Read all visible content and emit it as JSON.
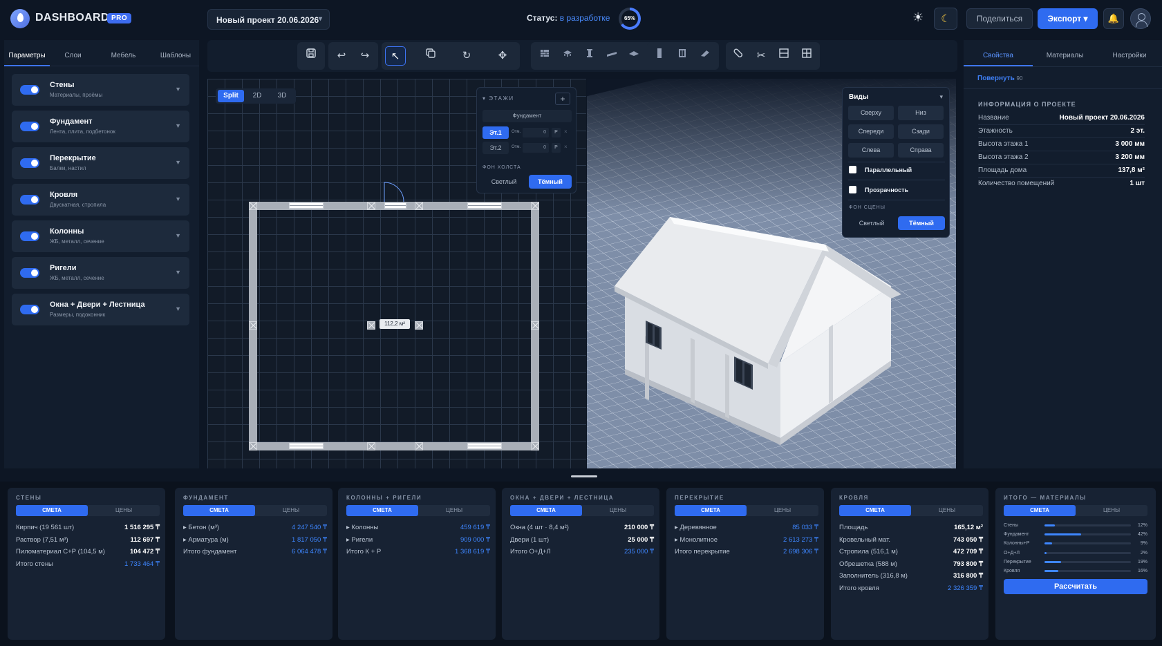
{
  "app": {
    "title": "DASHBOARD",
    "badge": "PRO"
  },
  "header": {
    "project": "Новый проект 20.06.2026",
    "status_label": "Статус:",
    "status_value": "в разработке",
    "progress_text": "65%",
    "progress_value": 65,
    "share": "Поделиться",
    "export": "Экспорт ▾"
  },
  "left": {
    "tabs": [
      "Параметры",
      "Слои",
      "Мебель",
      "Шаблоны"
    ],
    "layers": [
      {
        "title": "Стены",
        "sub": "Материалы, проёмы"
      },
      {
        "title": "Фундамент",
        "sub": "Лента, плита, подбетонок"
      },
      {
        "title": "Перекрытие",
        "sub": "Балки, настил"
      },
      {
        "title": "Кровля",
        "sub": "Двускатная, стропила"
      },
      {
        "title": "Колонны",
        "sub": "ЖБ, металл, сечение"
      },
      {
        "title": "Ригели",
        "sub": "ЖБ, металл, сечение"
      },
      {
        "title": "Окна + Двери + Лестница",
        "sub": "Размеры, подоконник"
      }
    ]
  },
  "canvas": {
    "modes": [
      "Split",
      "2D",
      "3D"
    ],
    "area": "112,2 м²",
    "floors": {
      "title": "▾ ЭТАЖИ",
      "plus": "+",
      "foundation": "Фундамент",
      "rows": [
        {
          "name": "Эт.1",
          "otm": "Отм.",
          "val": "0",
          "p": "Р",
          "x": "×"
        },
        {
          "name": "Эт.2",
          "otm": "Отм.",
          "val": "0",
          "p": "Р",
          "x": "×"
        }
      ],
      "bg_title": "ФОН ХОЛСТА",
      "light": "Светлый",
      "dark": "Тёмный"
    }
  },
  "views": {
    "title": "Виды",
    "chev": "▾",
    "buttons": [
      "Сверху",
      "Низ",
      "Спереди",
      "Сзади",
      "Слева",
      "Справа"
    ],
    "parallel": "Параллельный",
    "transparent": "Прозрачность",
    "bg_title": "ФОН СЦЕНЫ",
    "light": "Светлый",
    "dark": "Тёмный"
  },
  "right": {
    "tabs": [
      "Свойства",
      "Материалы",
      "Настройки"
    ],
    "sub": "Повернуть",
    "sub_hint": "90",
    "section": "ИНФОРМАЦИЯ О ПРОЕКТЕ",
    "props": [
      {
        "k": "Название",
        "v": "Новый проект 20.06.2026"
      },
      {
        "k": "Этажность",
        "v": "2 эт."
      },
      {
        "k": "Высота этажа 1",
        "v": "3 000 мм"
      },
      {
        "k": "Высота этажа 2",
        "v": "3 200 мм"
      },
      {
        "k": "Площадь дома",
        "v": "137,8 м²"
      },
      {
        "k": "Количество помещений",
        "v": "1 шт"
      }
    ]
  },
  "bottom": {
    "seg_a": "СМЕТА",
    "seg_b": "ЦЕНЫ",
    "cards": [
      {
        "title": "СТЕНЫ",
        "rows": [
          {
            "k": "Кирпич (19 561 шт)",
            "v": "1 516 295 ₸",
            "blue": false
          },
          {
            "k": "Раствор (7,51 м³)",
            "v": "112 697 ₸",
            "blue": false
          },
          {
            "k": "Пиломатериал С+Р (104,5 м)",
            "v": "104 472 ₸",
            "blue": false
          },
          {
            "k": "Итого стены",
            "v": "1 733 464 ₸",
            "blue": true
          }
        ]
      },
      {
        "title": "ФУНДАМЕНТ",
        "rows": [
          {
            "k": "▸ Бетон (м³)",
            "v": "4 247 540 ₸",
            "blue": true
          },
          {
            "k": "▸ Арматура (м)",
            "v": "1 817 050 ₸",
            "blue": true
          },
          {
            "k": "Итого фундамент",
            "v": "6 064 478 ₸",
            "blue": true
          }
        ]
      },
      {
        "title": "КОЛОННЫ + РИГЕЛИ",
        "rows": [
          {
            "k": "▸ Колонны",
            "v": "459 619 ₸",
            "blue": true
          },
          {
            "k": "▸ Ригели",
            "v": "909 000 ₸",
            "blue": true
          },
          {
            "k": "Итого К + Р",
            "v": "1 368 619 ₸",
            "blue": true
          }
        ]
      },
      {
        "title": "ОКНА + ДВЕРИ + ЛЕСТНИЦА",
        "rows": [
          {
            "k": "Окна (4 шт · 8,4 м²)",
            "v": "210 000 ₸",
            "blue": false
          },
          {
            "k": "Двери (1 шт)",
            "v": "25 000 ₸",
            "blue": false
          },
          {
            "k": "Итого О+Д+Л",
            "v": "235 000 ₸",
            "blue": true
          }
        ]
      },
      {
        "title": "ПЕРЕКРЫТИЕ",
        "rows": [
          {
            "k": "▸ Деревянное",
            "v": "85 033 ₸",
            "blue": true
          },
          {
            "k": "▸ Монолитное",
            "v": "2 613 273 ₸",
            "blue": true
          },
          {
            "k": "Итого перекрытие",
            "v": "2 698 306 ₸",
            "blue": true
          }
        ]
      },
      {
        "title": "КРОВЛЯ",
        "rows": [
          {
            "k": "Площадь",
            "v": "165,12 м²",
            "blue": false
          },
          {
            "k": "Кровельный мат.",
            "v": "743 050 ₸",
            "blue": false
          },
          {
            "k": "Стропила (516,1 м)",
            "v": "472 709 ₸",
            "blue": false
          },
          {
            "k": "Обрешетка (588 м)",
            "v": "793 800 ₸",
            "blue": false
          },
          {
            "k": "Заполнитель (316,8 м)",
            "v": "316 800 ₸",
            "blue": false
          },
          {
            "k": "Итого кровля",
            "v": "2 326 359 ₸",
            "blue": true
          }
        ]
      }
    ],
    "totals": {
      "title": "ИТОГО — МАТЕРИАЛЫ",
      "bars": [
        {
          "k": "Стены",
          "pct": "12%",
          "value": 12
        },
        {
          "k": "Фундамент",
          "pct": "42%",
          "value": 42
        },
        {
          "k": "Колонны+Р",
          "pct": "9%",
          "value": 9
        },
        {
          "k": "О+Д+Л",
          "pct": "2%",
          "value": 2
        },
        {
          "k": "Перекрытие",
          "pct": "19%",
          "value": 19
        },
        {
          "k": "Кровля",
          "pct": "16%",
          "value": 16
        }
      ],
      "button": "Рассчитать"
    }
  },
  "colors": {
    "accent": "#2f6bf0",
    "bg": "#0d1624",
    "panel": "#121d2d",
    "value_blue": "#3e86ff"
  }
}
